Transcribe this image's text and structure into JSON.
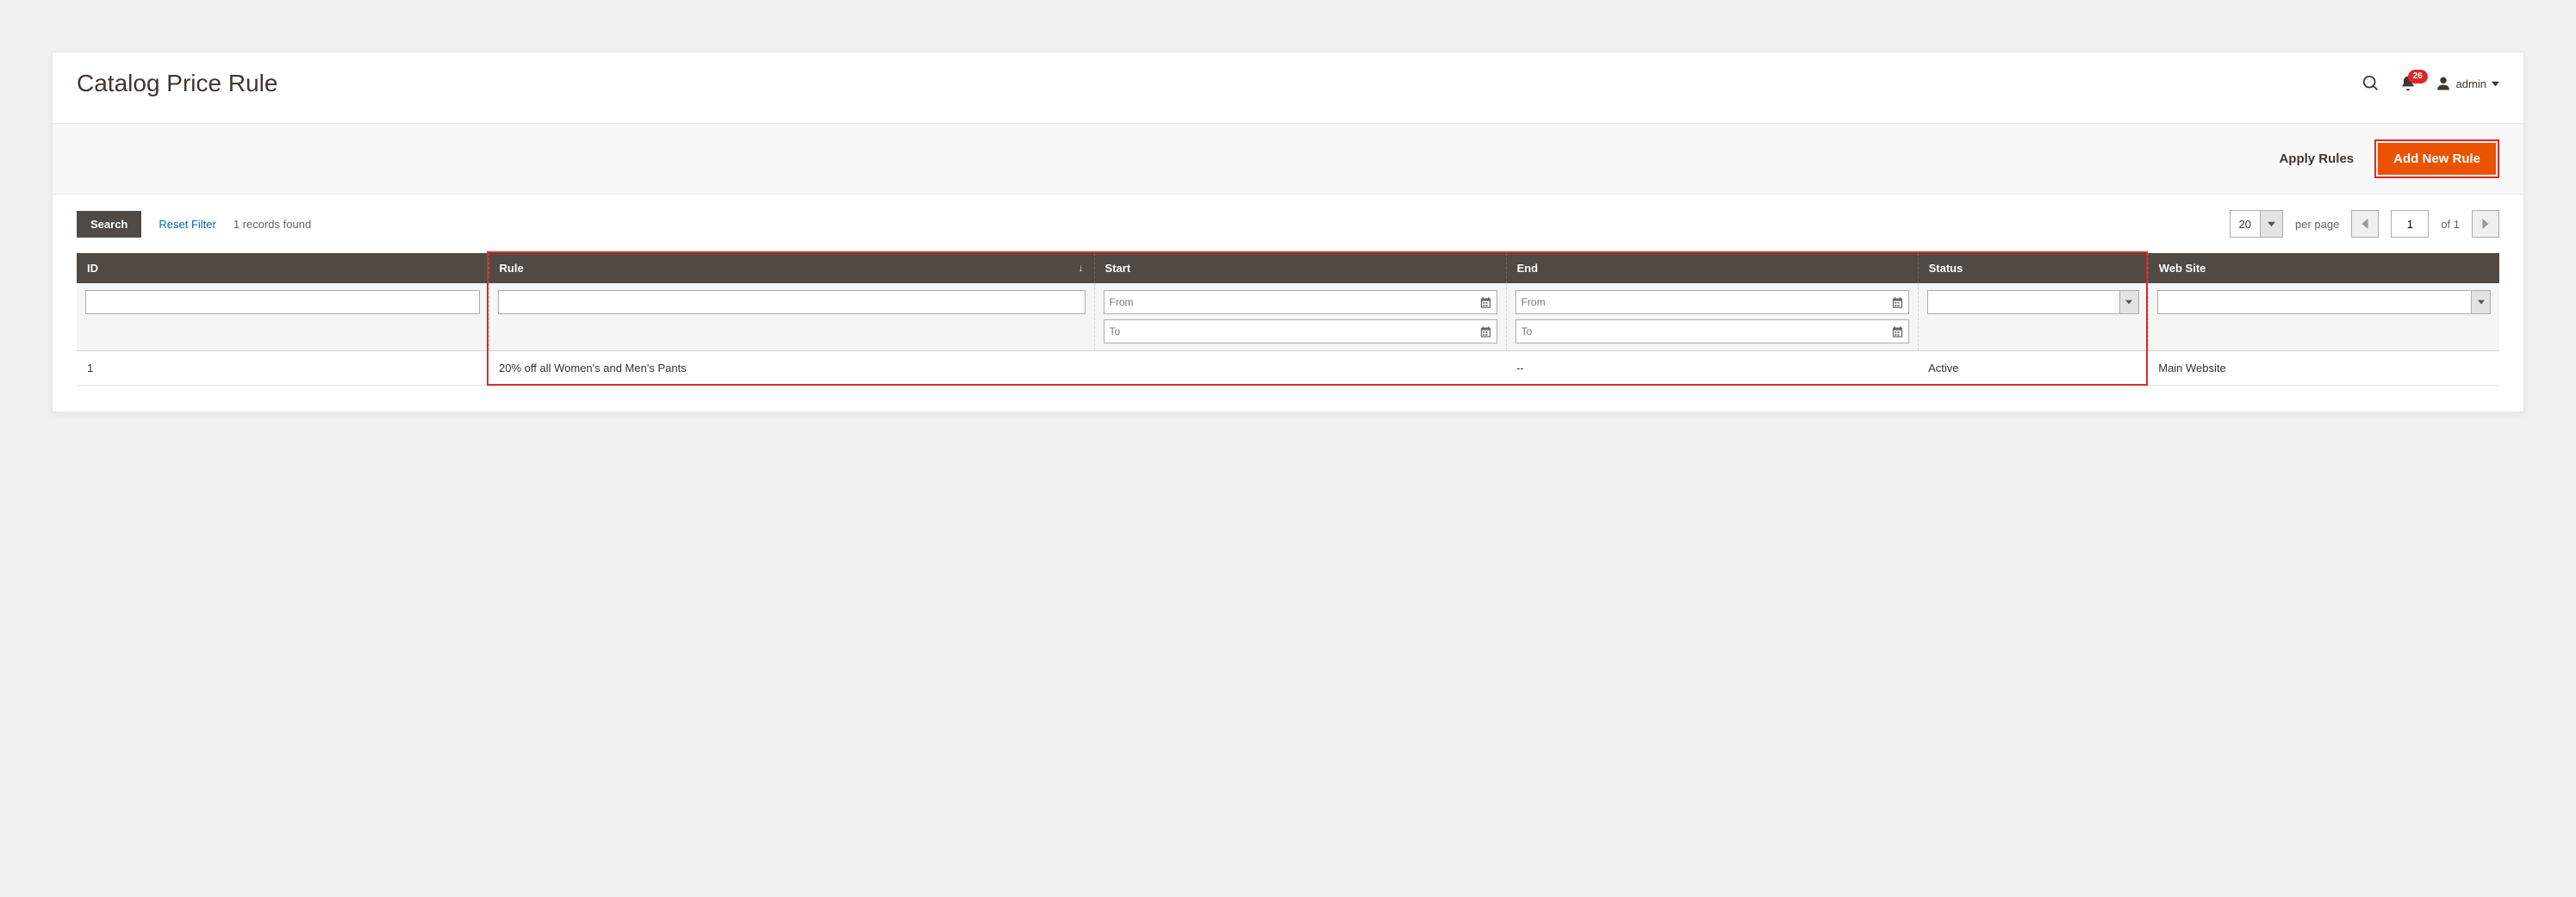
{
  "header": {
    "title": "Catalog Price Rule",
    "notification_count": "26",
    "user_name": "admin"
  },
  "actions": {
    "apply_rules": "Apply Rules",
    "add_new_rule": "Add New Rule"
  },
  "grid_controls": {
    "search": "Search",
    "reset_filter": "Reset Filter",
    "records_found": "1 records found",
    "page_size": "20",
    "per_page_label": "per page",
    "current_page": "1",
    "of_label": "of 1"
  },
  "columns": {
    "id": "ID",
    "rule": "Rule",
    "start": "Start",
    "end": "End",
    "status": "Status",
    "website": "Web Site"
  },
  "filters": {
    "from_placeholder": "From",
    "to_placeholder": "To"
  },
  "rows": [
    {
      "id": "1",
      "rule": "20% off all Women's and Men's Pants",
      "start": "",
      "end": "--",
      "status": "Active",
      "website": "Main Website"
    }
  ]
}
